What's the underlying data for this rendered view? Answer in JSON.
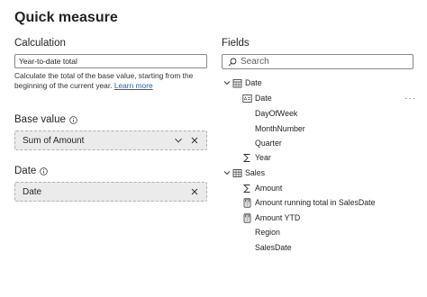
{
  "dialog": {
    "title": "Quick measure"
  },
  "calculation": {
    "label": "Calculation",
    "selected": "Year-to-date total",
    "description": "Calculate the total of the base value, starting from the beginning of the current year.",
    "learn_more": "Learn more"
  },
  "base_value": {
    "label": "Base value",
    "field": "Sum of Amount"
  },
  "date": {
    "label": "Date",
    "field": "Date"
  },
  "fields": {
    "label": "Fields",
    "search_placeholder": "Search",
    "tree": {
      "date_table": "Date",
      "date_items": [
        "Date",
        "DayOfWeek",
        "MonthNumber",
        "Quarter",
        "Year"
      ],
      "sales_table": "Sales",
      "sales_items": [
        "Amount",
        "Amount running total in SalesDate",
        "Amount YTD",
        "Region",
        "SalesDate"
      ]
    },
    "more_options": "···"
  },
  "colors": {
    "accent": "#1f62b5",
    "well_bg": "#ebebeb",
    "border": "#8a8886"
  }
}
